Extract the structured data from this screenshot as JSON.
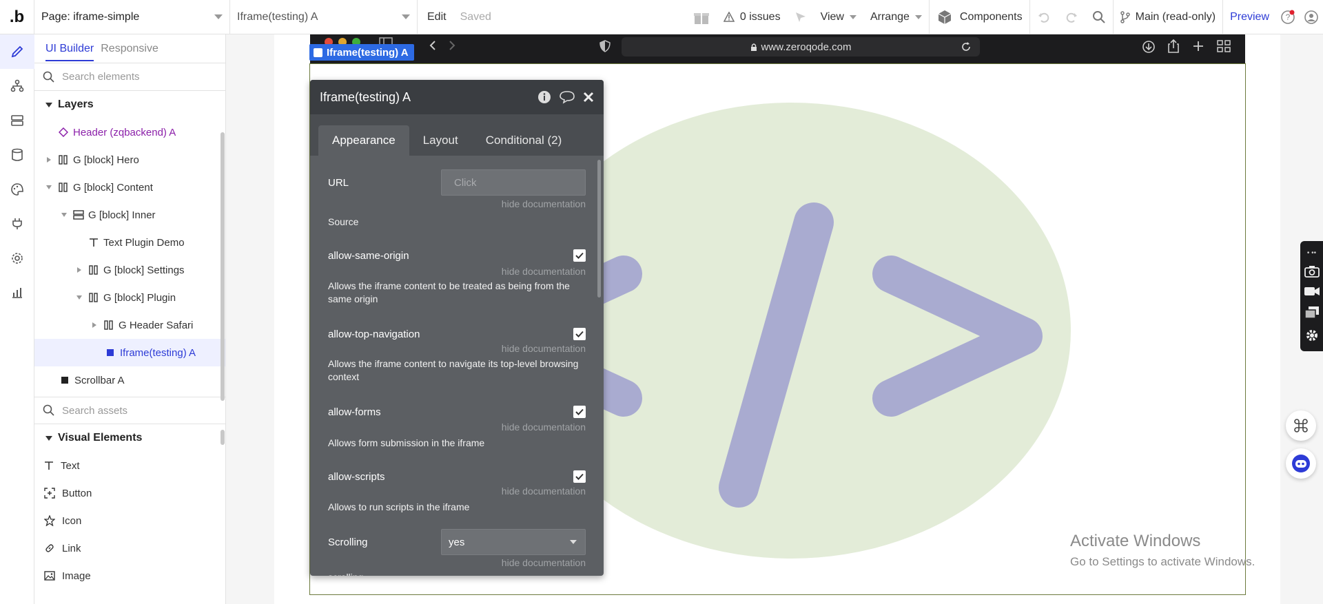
{
  "topbar": {
    "logo": ".b",
    "page_select": "Page: iframe-simple",
    "element_select": "Iframe(testing) A",
    "edit": "Edit",
    "saved": "Saved",
    "issues": "0 issues",
    "view": "View",
    "arrange": "Arrange",
    "components": "Components",
    "branch": "Main (read-only)",
    "preview": "Preview"
  },
  "panel": {
    "tab_ui_builder": "UI Builder",
    "tab_responsive": "Responsive",
    "search_elements_placeholder": "Search elements",
    "layers_title": "Layers",
    "layers": [
      {
        "label": "Header (zqbackend) A"
      },
      {
        "label": "G [block] Hero"
      },
      {
        "label": "G [block] Content"
      },
      {
        "label": "G [block] Inner"
      },
      {
        "label": "Text Plugin Demo"
      },
      {
        "label": "G [block] Settings"
      },
      {
        "label": "G [block] Plugin"
      },
      {
        "label": "G Header Safari"
      },
      {
        "label": "Iframe(testing) A"
      },
      {
        "label": "Scrollbar A"
      }
    ],
    "search_assets_placeholder": "Search assets",
    "visual_elements_title": "Visual Elements",
    "visual_elements": [
      {
        "label": "Text"
      },
      {
        "label": "Button"
      },
      {
        "label": "Icon"
      },
      {
        "label": "Link"
      },
      {
        "label": "Image"
      }
    ]
  },
  "canvas": {
    "selected_label": "Iframe(testing) A",
    "url": "www.zeroqode.com",
    "watermark_title": "Activate Windows",
    "watermark_sub": "Go to Settings to activate Windows."
  },
  "editor": {
    "title": "Iframe(testing) A",
    "tabs": [
      {
        "label": "Appearance"
      },
      {
        "label": "Layout"
      },
      {
        "label": "Conditional (2)"
      }
    ],
    "url_label": "URL",
    "url_placeholder": "Click",
    "hide_doc": "hide documentation",
    "source_label": "Source",
    "options": [
      {
        "label": "allow-same-origin",
        "desc": "Allows the iframe content to be treated as being from the same origin"
      },
      {
        "label": "allow-top-navigation",
        "desc": "Allows the iframe content to navigate its top-level browsing context"
      },
      {
        "label": "allow-forms",
        "desc": "Allows form submission in the iframe"
      },
      {
        "label": "allow-scripts",
        "desc": "Allows to run scripts in the iframe"
      }
    ],
    "scrolling_label": "Scrolling",
    "scrolling_value": "yes",
    "scrolling_desc": "scrolling"
  },
  "colors": {
    "accent": "#2d3bd6",
    "editor_bg": "#5c5f63",
    "logo_circle": "#e3ecd8",
    "logo_symbol": "#a9abd0"
  }
}
